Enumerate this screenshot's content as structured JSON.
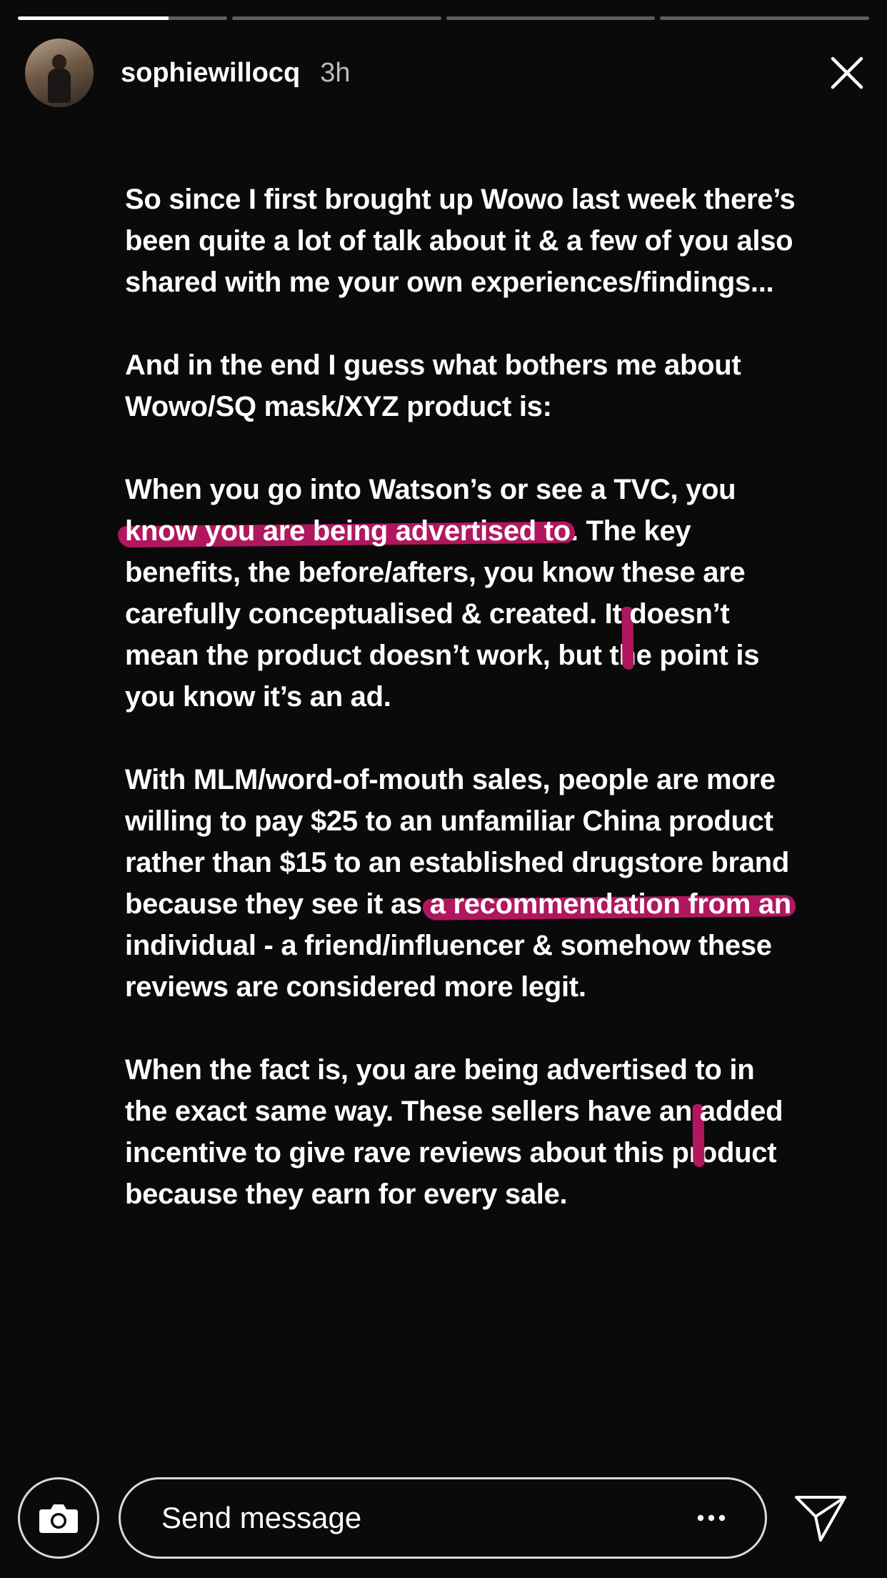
{
  "story": {
    "progress_segments": [
      {
        "fill": 0.72
      },
      {
        "fill": 0
      },
      {
        "fill": 0
      },
      {
        "fill": 0
      }
    ],
    "username": "sophiewillocq",
    "time": "3h",
    "icons": {
      "close": "close-icon",
      "camera": "camera-icon",
      "more": "more-dots-icon",
      "send": "send-icon"
    },
    "highlight_color": "#b0175f",
    "paragraphs": [
      {
        "segments": [
          {
            "text": "So since I first brought up Wowo last week there’s been quite a lot of talk about it & a few of you also shared with me your own experiences/findings...",
            "highlight": false
          }
        ]
      },
      {
        "segments": [
          {
            "text": "And in the end I guess what bothers me about Wowo/SQ mask/XYZ product is:",
            "highlight": false
          }
        ]
      },
      {
        "segments": [
          {
            "text": "When you go into Watson’s or see a TVC, you ",
            "highlight": false
          },
          {
            "text": "know you are being advertised to",
            "highlight": true
          },
          {
            "text": ". The key benefits, the before/afters, you know these are carefully conceptualised & created. It ",
            "highlight": false
          },
          {
            "text": "doesn’t mean the product doesn’t work",
            "highlight": true
          },
          {
            "text": ", but the point is you know it’s an ad.",
            "highlight": false
          }
        ]
      },
      {
        "segments": [
          {
            "text": "With MLM/word-of-mouth sales, people are more willing to pay $25 to an unfamiliar China product rather than $15 to an established drugstore brand because they see it as ",
            "highlight": false
          },
          {
            "text": "a recommendation from an",
            "highlight": true
          },
          {
            "text": " individual - a friend/influencer & somehow these reviews are considered more legit.",
            "highlight": false
          }
        ]
      },
      {
        "segments": [
          {
            "text": "When the fact is, you are being advertised to in the exact same way. These sellers have an ",
            "highlight": false
          },
          {
            "text": "added incentive to give rave reviews",
            "highlight": true
          },
          {
            "text": " about this product because they earn for every sale.",
            "highlight": false
          }
        ]
      }
    ]
  },
  "composer": {
    "placeholder": "Send message"
  }
}
